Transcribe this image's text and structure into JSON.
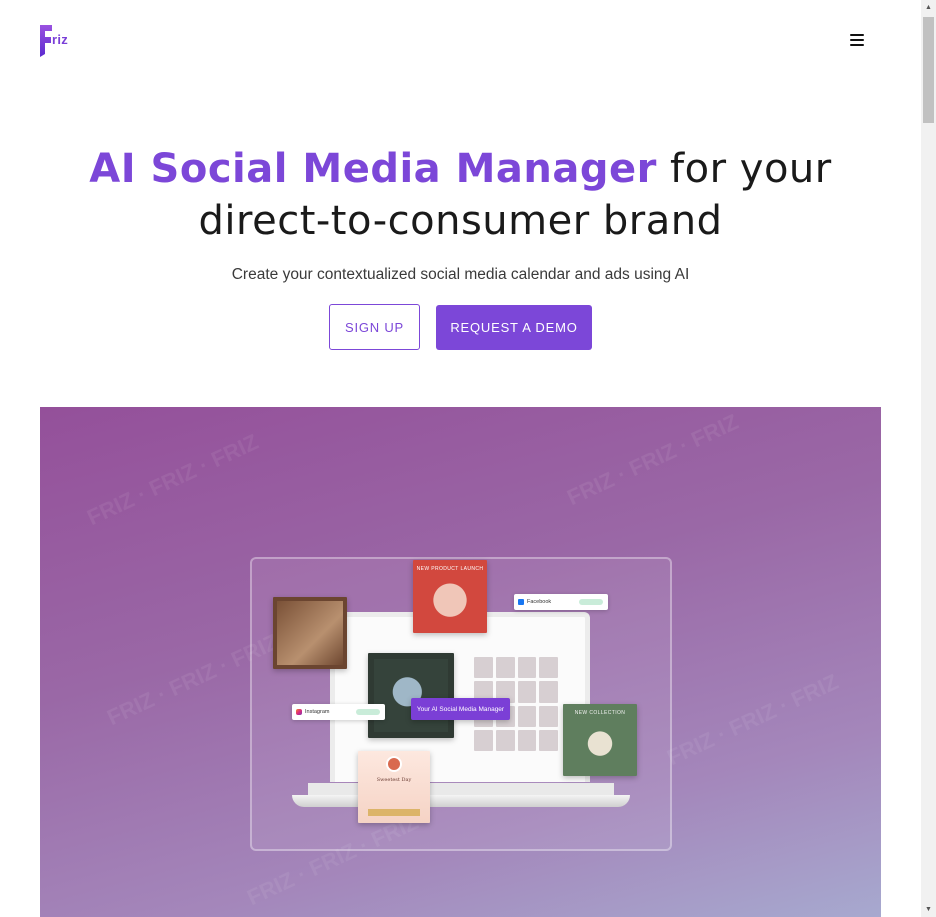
{
  "brand": {
    "logo_text": "riz",
    "accent_color": "#7c47d8"
  },
  "header": {
    "menu_icon": "hamburger-menu-icon"
  },
  "hero": {
    "title_accent": "AI Social Media Manager",
    "title_rest": " for your direct-to-consumer brand",
    "subtitle": "Create your contextualized social media calendar and ads using AI",
    "signup_label": "SIGN UP",
    "demo_label": "REQUEST A DEMO"
  },
  "media": {
    "launch_card_label": "NEW PRODUCT LAUNCH",
    "candle_card_label": "NEW COLLECTION",
    "bday_card_label": "Sweetest Day",
    "facebook_label": "Facebook",
    "instagram_label": "Instagram",
    "ai_badge_label": "Your AI Social Media Manager"
  },
  "scrollbar": {
    "up_icon": "scroll-up-arrow-icon",
    "down_icon": "scroll-down-arrow-icon"
  }
}
